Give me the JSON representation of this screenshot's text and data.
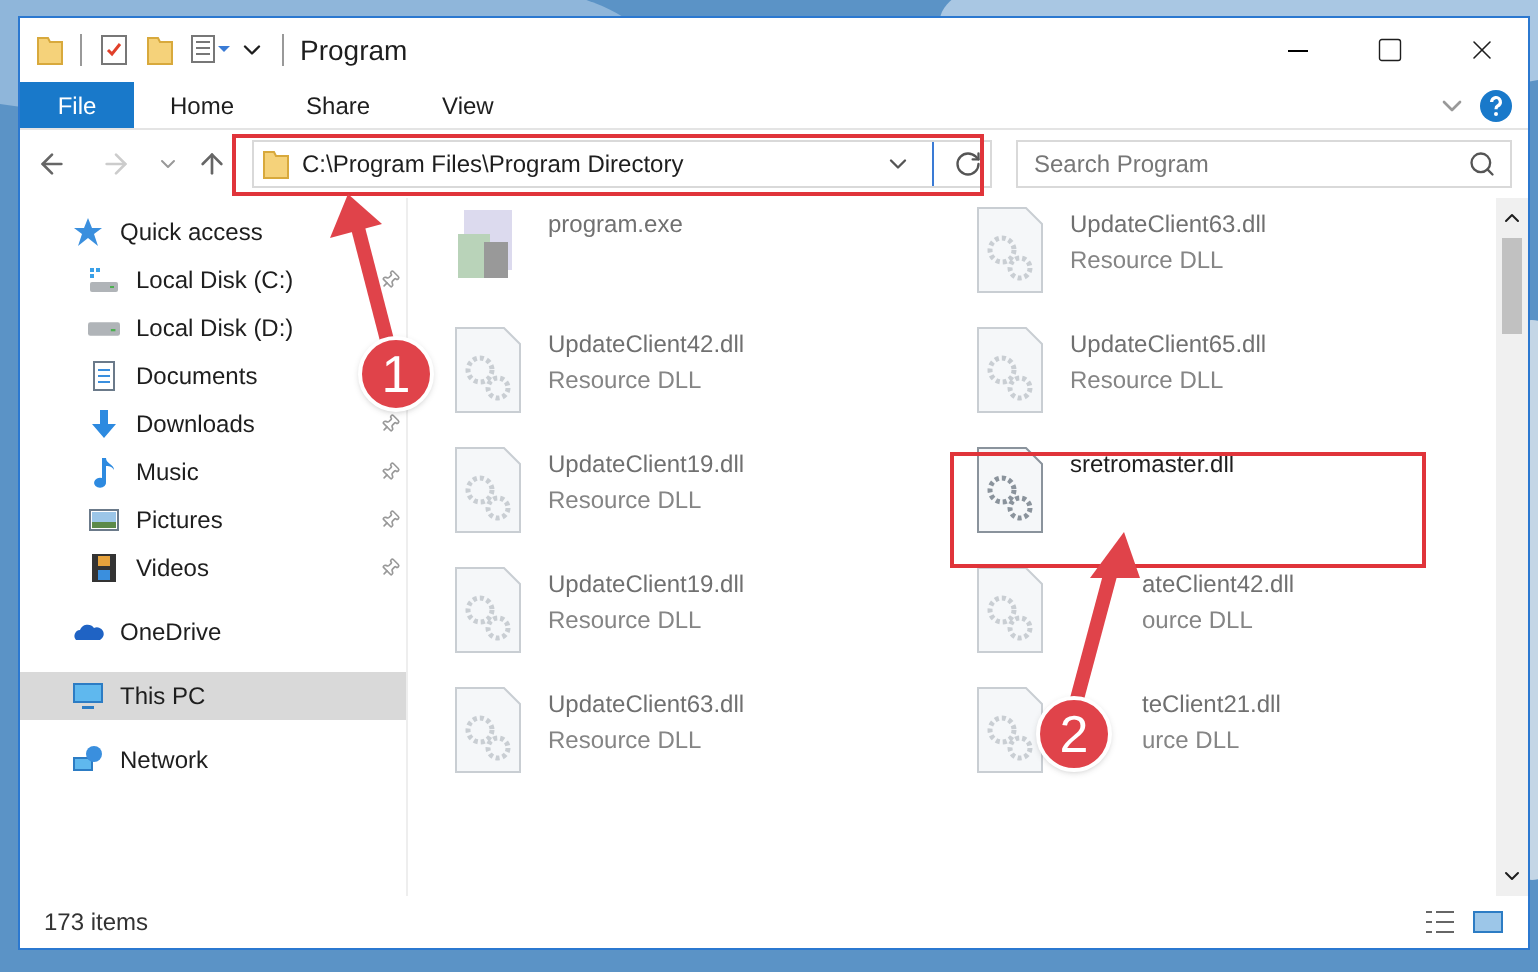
{
  "window": {
    "title": "Program"
  },
  "ribbon_tabs": [
    {
      "label": "File",
      "selected": true
    },
    {
      "label": "Home",
      "selected": false
    },
    {
      "label": "Share",
      "selected": false
    },
    {
      "label": "View",
      "selected": false
    }
  ],
  "address_bar": {
    "path": "C:\\Program Files\\Program Directory"
  },
  "search": {
    "placeholder": "Search Program"
  },
  "nav_pane": {
    "items": [
      {
        "label": "Quick access",
        "kind": "star",
        "selected": false,
        "children": [
          {
            "label": "Local Disk (C:)",
            "kind": "drive-c",
            "pinned": true,
            "selected": false
          },
          {
            "label": "Local Disk (D:)",
            "kind": "drive",
            "pinned": false,
            "selected": false
          },
          {
            "label": "Documents",
            "kind": "document",
            "pinned": false,
            "selected": false
          },
          {
            "label": "Downloads",
            "kind": "download",
            "pinned": true,
            "selected": false
          },
          {
            "label": "Music",
            "kind": "music",
            "pinned": true,
            "selected": false
          },
          {
            "label": "Pictures",
            "kind": "pictures",
            "pinned": true,
            "selected": false
          },
          {
            "label": "Videos",
            "kind": "videos",
            "pinned": true,
            "selected": false
          }
        ]
      },
      {
        "label": "OneDrive",
        "kind": "cloud",
        "selected": false
      },
      {
        "label": "This PC",
        "kind": "pc",
        "selected": true
      },
      {
        "label": "Network",
        "kind": "network",
        "selected": false
      }
    ]
  },
  "files": [
    {
      "name": "program.exe",
      "kind": "exe",
      "blurred": true
    },
    {
      "name": "UpdateClient63.dll",
      "type": "Resource DLL",
      "kind": "dll",
      "blurred": true
    },
    {
      "name": "UpdateClient42.dll",
      "type": "Resource DLL",
      "kind": "dll",
      "blurred": true
    },
    {
      "name": "UpdateClient65.dll",
      "type": "Resource DLL",
      "kind": "dll",
      "blurred": true
    },
    {
      "name": "UpdateClient19.dll",
      "type": "Resource DLL",
      "kind": "dll",
      "blurred": true
    },
    {
      "name": "sretromaster.dll",
      "kind": "dll",
      "blurred": false
    },
    {
      "name": "UpdateClient19.dll",
      "type": "Resource DLL",
      "kind": "dll",
      "blurred": true
    },
    {
      "name": "ateClient42.dll",
      "type": "ource DLL",
      "kind": "dll-covered",
      "blurred": true
    },
    {
      "name": "UpdateClient63.dll",
      "type": "Resource DLL",
      "kind": "dll",
      "blurred": true
    },
    {
      "name": "teClient21.dll",
      "type": "urce DLL",
      "kind": "dll-covered",
      "blurred": true
    }
  ],
  "status_bar": {
    "item_count": "173 items"
  },
  "annotations": [
    {
      "number": "1"
    },
    {
      "number": "2"
    }
  ]
}
